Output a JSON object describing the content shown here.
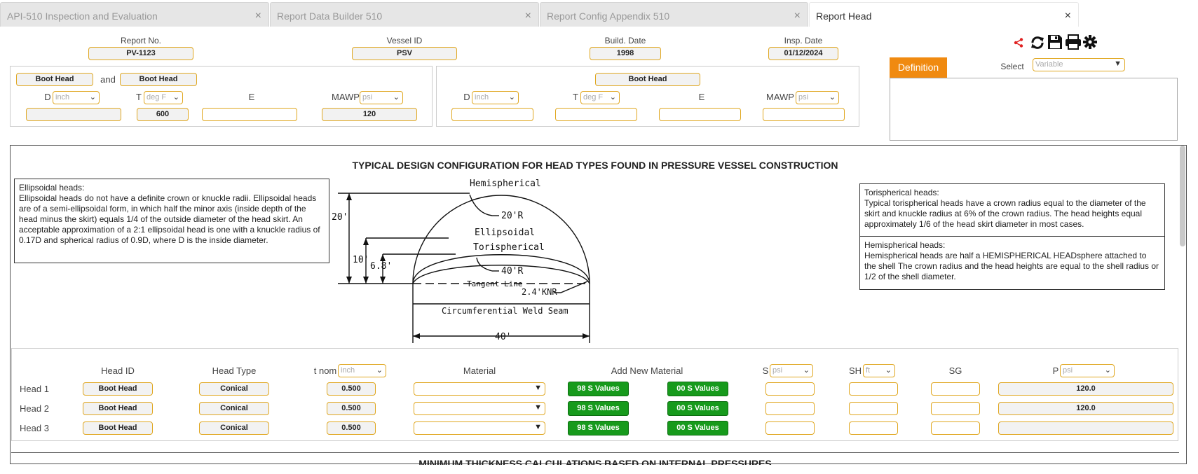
{
  "tabs": [
    {
      "label": "API-510 Inspection and Evaluation"
    },
    {
      "label": "Report Data Builder 510"
    },
    {
      "label": "Report Config Appendix 510"
    },
    {
      "label": "Report Head"
    }
  ],
  "close_glyph": "×",
  "top": {
    "report_no": {
      "label": "Report No.",
      "value": "PV-1123"
    },
    "vessel_id": {
      "label": "Vessel ID",
      "value": "PSV"
    },
    "build_date": {
      "label": "Build. Date",
      "value": "1998"
    },
    "insp_date": {
      "label": "Insp. Date",
      "value": "01/12/2024"
    }
  },
  "left_panel": {
    "head_a": "Boot Head",
    "and": "and",
    "head_b": "Boot Head",
    "d_label": "D",
    "d_unit": "inch",
    "t_label": "T",
    "t_unit": "deg F",
    "e_label": "E",
    "mawp_label": "MAWP",
    "mawp_unit": "psi",
    "d_value": "",
    "t_value": "600",
    "e_value": "",
    "mawp_value": "120"
  },
  "right_panel": {
    "head": "Boot Head",
    "d_label": "D",
    "d_unit": "inch",
    "t_label": "T",
    "t_unit": "deg F",
    "e_label": "E",
    "mawp_label": "MAWP",
    "mawp_unit": "psi"
  },
  "definition": {
    "tab": "Definition",
    "select_label": "Select",
    "select_placeholder": "Variable"
  },
  "accent_colors": {
    "orange": "#f08a10",
    "green": "#179a1c",
    "field_border": "#e0a720",
    "share_red": "#e02020"
  },
  "diagram": {
    "title": "TYPICAL DESIGN CONFIGURATION FOR HEAD TYPES FOUND IN PRESSURE VESSEL CONSTRUCTION",
    "hemispherical": "Hemispherical",
    "ellipsoidal": "Ellipsoidal",
    "torispherical": "Torispherical",
    "r20": "20'R",
    "r40": "40'R",
    "d20": "20'",
    "d10": "10'",
    "d68": "6.8'",
    "tangent": "Tangent Line",
    "knr": "2.4'KNR",
    "weld": "Circumferential Weld Seam",
    "width": "40'"
  },
  "notes": {
    "ellipsoidal": "Ellipsoidal heads:\nEllipsoidal heads do not have a definite crown or knuckle radii. Ellipsoidal heads are of a semi-ellipsoidal form, in which half the minor axis (inside depth of the head minus the skirt) equals 1/4 of the outside diameter of the head skirt. An acceptable approximation of a 2:1 ellipsoidal head is one with a knuckle radius of 0.17D and spherical radius of 0.9D, where D is the inside diameter.",
    "torispherical": "Torispherical heads:\nTypical torispherical heads have a crown radius equal to the diameter of the skirt and knuckle radius at 6% of the crown radius. The head heights equal approximately 1/6 of the head skirt diameter in most cases.",
    "hemispherical": "Hemispherical heads:\nHemispherical heads are half a HEMISPHERICAL HEADsphere attached to the shell The crown radius and the head heights are equal to the shell radius or 1/2 of the shell diameter."
  },
  "table": {
    "headers": {
      "head_id": "Head ID",
      "head_type": "Head Type",
      "t_nom": "t nom",
      "t_nom_unit": "inch",
      "material": "Material",
      "add_new_material": "Add New Material",
      "s": "S",
      "s_unit": "psi",
      "sh": "SH",
      "sh_unit": "ft",
      "sg": "SG",
      "p": "P",
      "p_unit": "psi"
    },
    "btn98": "98 S Values",
    "btn00": "00 S Values",
    "rows": [
      {
        "name": "Head 1",
        "id": "Boot Head",
        "type": "Conical",
        "tnom": "0.500",
        "p": "120.0"
      },
      {
        "name": "Head 2",
        "id": "Boot Head",
        "type": "Conical",
        "tnom": "0.500",
        "p": "120.0"
      },
      {
        "name": "Head 3",
        "id": "Boot Head",
        "type": "Conical",
        "tnom": "0.500",
        "p": ""
      }
    ]
  },
  "next_section": "MINIMUM THICKNESS CALCULATIONS BASED ON INTERNAL PRESSURES"
}
